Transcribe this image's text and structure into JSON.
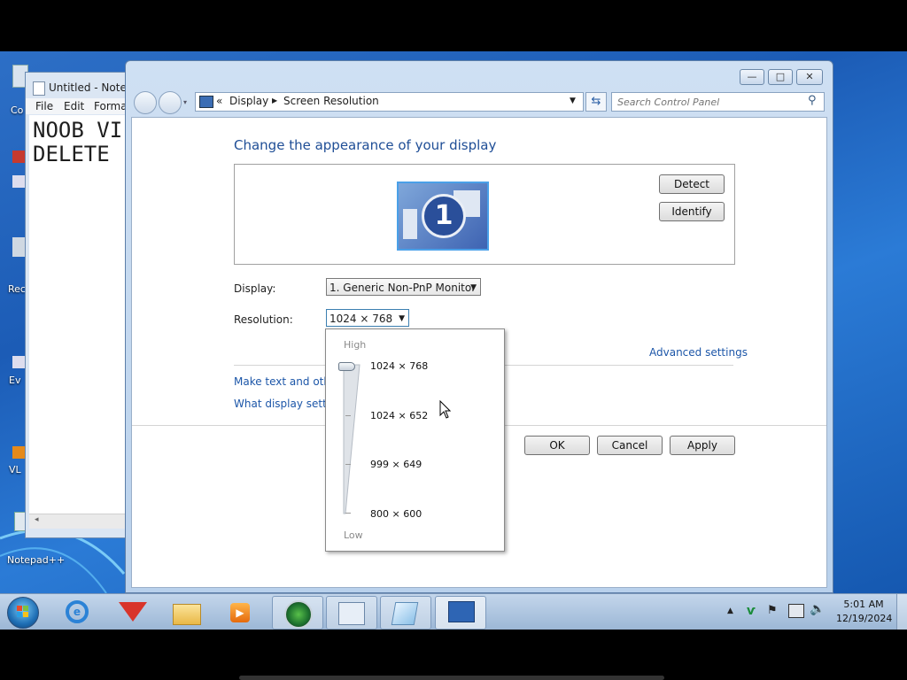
{
  "desktop": {
    "icons": [
      {
        "label": "Co",
        "icon": "computer-icon"
      },
      {
        "label": "Rec",
        "icon": "recycle-bin-icon"
      },
      {
        "label": "Ev",
        "icon": "shortcut-icon"
      },
      {
        "label": "VL",
        "icon": "vlc-icon"
      },
      {
        "label": "Notepad++",
        "icon": "notepadpp-icon"
      }
    ]
  },
  "notepad": {
    "title": "Untitled - Notep",
    "menu": [
      "File",
      "Edit",
      "Forma"
    ],
    "lines": [
      "NOOB VI",
      "DELETE"
    ]
  },
  "window": {
    "caption_buttons": {
      "minimize": "—",
      "maximize": "□",
      "close": "✕"
    },
    "breadcrumb": {
      "overflow": "«",
      "items": [
        "Display",
        "Screen Resolution"
      ]
    },
    "search_placeholder": "Search Control Panel",
    "heading": "Change the appearance of your display",
    "monitor_number": "1",
    "detect_label": "Detect",
    "identify_label": "Identify",
    "display_label": "Display:",
    "display_value": "1. Generic Non-PnP Monitor",
    "resolution_label": "Resolution:",
    "resolution_value": "1024 × 768",
    "advanced_link": "Advanced settings",
    "link1": "Make text and other",
    "link2": "What display setting",
    "ok_label": "OK",
    "cancel_label": "Cancel",
    "apply_label": "Apply"
  },
  "resolution_dropdown": {
    "high_label": "High",
    "low_label": "Low",
    "options": [
      "1024 × 768",
      "1024 × 652",
      "999 × 649",
      "800 × 600"
    ],
    "selected": "1024 × 768"
  },
  "taskbar": {
    "start_icon": "windows-orb-icon",
    "items": [
      {
        "icon": "internet-explorer-icon",
        "open": false
      },
      {
        "icon": "app-red-icon",
        "open": false
      },
      {
        "icon": "folder-icon",
        "open": false
      },
      {
        "icon": "media-player-icon",
        "open": false
      },
      {
        "icon": "browser-globe-icon",
        "open": true
      },
      {
        "icon": "window-app-icon",
        "open": true
      },
      {
        "icon": "notepad-icon",
        "open": true
      },
      {
        "icon": "control-panel-icon",
        "open": true
      }
    ],
    "clock": {
      "time": "5:01 AM",
      "date": "12/19/2024"
    }
  },
  "colors": {
    "link": "#1c56a8",
    "heading": "#1f4e96",
    "taskbar": "#b4cae3"
  }
}
